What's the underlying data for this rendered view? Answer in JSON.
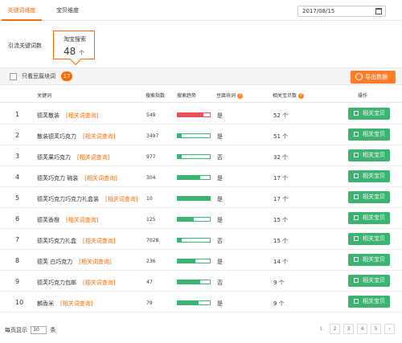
{
  "tabs": [
    {
      "label": "关键词维度"
    },
    {
      "label": "宝贝维度"
    }
  ],
  "date": "2017/08/15",
  "cards": {
    "plain_label": "引流关键词数",
    "active_label": "淘宝搜索",
    "active_count": "48",
    "active_unit": "个"
  },
  "toolbar": {
    "checkbox_label": "只看豆腐块词",
    "badge": "17",
    "export_label": "导出数据"
  },
  "table": {
    "headers": [
      "关键词",
      "搜索指数",
      "搜索趋势",
      "豆腐块词",
      "相关宝贝数",
      "操作"
    ],
    "link_label": "[相关词查询]",
    "action_label": "相关宝贝",
    "rows": [
      {
        "idx": "1",
        "kw": "德芙散装",
        "index": "549",
        "trend": 0.8,
        "trend_color": "#e5535a",
        "tofu": "是",
        "count": "52 个"
      },
      {
        "idx": "2",
        "kw": "散装德芙巧克力",
        "index": "3497",
        "trend": 0.12,
        "trend_color": "#3cb371",
        "tofu": "是",
        "count": "51 个"
      },
      {
        "idx": "3",
        "kw": "德芙果巧克力",
        "index": "977",
        "trend": 0.12,
        "trend_color": "#3cb371",
        "tofu": "否",
        "count": "32 个"
      },
      {
        "idx": "4",
        "kw": "德芙巧克力 碗装",
        "index": "304",
        "trend": 0.7,
        "trend_color": "#3cb371",
        "tofu": "是",
        "count": "17 个"
      },
      {
        "idx": "5",
        "kw": "德芙巧克力巧克力礼盒装",
        "index": "10",
        "trend": 1.0,
        "trend_color": "#3cb371",
        "tofu": "是",
        "count": "17 个"
      },
      {
        "idx": "6",
        "kw": "德芙香橙",
        "index": "125",
        "trend": 0.5,
        "trend_color": "#3cb371",
        "tofu": "是",
        "count": "15 个"
      },
      {
        "idx": "7",
        "kw": "德芙巧克力礼盒",
        "index": "7028",
        "trend": 0.12,
        "trend_color": "#3cb371",
        "tofu": "否",
        "count": "15 个"
      },
      {
        "idx": "8",
        "kw": "德芙 白巧克力",
        "index": "236",
        "trend": 0.55,
        "trend_color": "#3cb371",
        "tofu": "是",
        "count": "14 个"
      },
      {
        "idx": "9",
        "kw": "德芙巧克力包邮",
        "index": "47",
        "trend": 0.7,
        "trend_color": "#3cb371",
        "tofu": "否",
        "count": "9 个"
      },
      {
        "idx": "10",
        "kw": "麟香米",
        "index": "79",
        "trend": 0.65,
        "trend_color": "#3cb371",
        "tofu": "是",
        "count": "9 个"
      }
    ]
  },
  "footer": {
    "per_page_prefix": "每页显示",
    "per_page_value": "10",
    "per_page_suffix": "条",
    "pages": [
      "1",
      "2",
      "3",
      "4",
      "5"
    ],
    "next": "›"
  }
}
